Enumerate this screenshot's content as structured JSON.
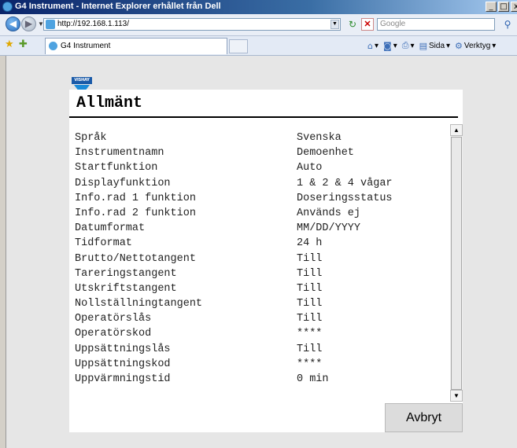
{
  "window": {
    "title": "G4 Instrument - Internet Explorer erhållet från Dell",
    "buttons": {
      "minimize": "_",
      "maximize": "□",
      "close": "x"
    }
  },
  "address_bar": {
    "url": "http://192.168.1.113/",
    "search_placeholder": "Google"
  },
  "tabs": [
    {
      "label": "G4 Instrument"
    }
  ],
  "command_bar": {
    "page_label": "Sida",
    "tools_label": "Verktyg"
  },
  "logo": {
    "text": "VISHAY"
  },
  "page": {
    "heading": "Allmänt",
    "settings": [
      {
        "label": "Språk",
        "value": "Svenska"
      },
      {
        "label": "Instrumentnamn",
        "value": "Demoenhet"
      },
      {
        "label": "Startfunktion",
        "value": "Auto"
      },
      {
        "label": "Displayfunktion",
        "value": "1 & 2 & 4 vågar"
      },
      {
        "label": "Info.rad 1 funktion",
        "value": "Doseringsstatus"
      },
      {
        "label": "Info.rad 2 funktion",
        "value": "Används ej"
      },
      {
        "label": "Datumformat",
        "value": "MM/DD/YYYY"
      },
      {
        "label": "Tidformat",
        "value": "24 h"
      },
      {
        "label": "Brutto/Nettotangent",
        "value": "Till"
      },
      {
        "label": "Tareringstangent",
        "value": "Till"
      },
      {
        "label": "Utskriftstangent",
        "value": "Till"
      },
      {
        "label": "Nollställningtangent",
        "value": "Till"
      },
      {
        "label": "Operatörslås",
        "value": "Till"
      },
      {
        "label": "Operatörskod",
        "value": "****"
      },
      {
        "label": "Uppsättningslås",
        "value": "Till"
      },
      {
        "label": "Uppsättningskod",
        "value": "****"
      },
      {
        "label": "Uppvärmningstid",
        "value": "0 min"
      }
    ],
    "cancel_label": "Avbryt"
  }
}
